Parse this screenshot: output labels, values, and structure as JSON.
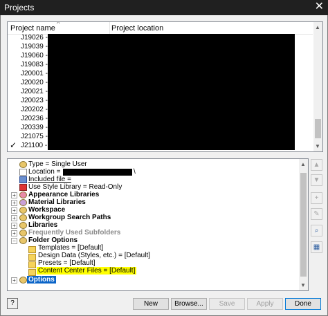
{
  "window": {
    "title": "Projects",
    "close_glyph": "✕"
  },
  "project_list": {
    "columns": [
      "Project name",
      "Project location"
    ],
    "rows": [
      "J19026 -",
      "J19039 -",
      "J19060 -",
      "J19083 -",
      "J20001 -",
      "J20020 -",
      "J20021 -",
      "J20023 -",
      "J20202 -",
      "J20236 -",
      "J20339 -",
      "J21075 -",
      "J21100 -"
    ],
    "active_row": "J21100 -",
    "check_glyph": "✓"
  },
  "tree": {
    "items": [
      {
        "label": "Type = Single User",
        "icon": "user-icon"
      },
      {
        "label": "Location =",
        "icon": "location-icon"
      },
      {
        "label": "Included file =",
        "icon": "file-icon"
      },
      {
        "label": "Use Style Library = Read-Only",
        "icon": "style-icon"
      },
      {
        "label": "Appearance Libraries",
        "icon": "appearance-icon"
      },
      {
        "label": "Material Libraries",
        "icon": "material-icon"
      },
      {
        "label": "Workspace",
        "icon": "folder-icon"
      },
      {
        "label": "Workgroup Search Paths",
        "icon": "folder-icon"
      },
      {
        "label": "Libraries",
        "icon": "folder-icon"
      },
      {
        "label": "Frequently Used Subfolders",
        "icon": "folder-icon"
      },
      {
        "label": "Folder Options",
        "icon": "folder-icon"
      },
      {
        "label": "Templates = [Default]",
        "icon": "folder-icon"
      },
      {
        "label": "Design Data (Styles, etc.) = [Default]",
        "icon": "folder-icon"
      },
      {
        "label": "Presets = [Default]",
        "icon": "folder-icon"
      },
      {
        "label": "Content Center Files = [Default]",
        "icon": "folder-icon"
      },
      {
        "label": "Options",
        "icon": "gear-icon"
      }
    ],
    "location_suffix": "\\"
  },
  "side_buttons": {
    "up": "▲",
    "down": "▼",
    "add": "+",
    "edit": "✎",
    "find": "⌕",
    "image": "▦"
  },
  "buttons": {
    "help": "?",
    "new": "New",
    "browse": "Browse...",
    "save": "Save",
    "apply": "Apply",
    "done": "Done"
  }
}
